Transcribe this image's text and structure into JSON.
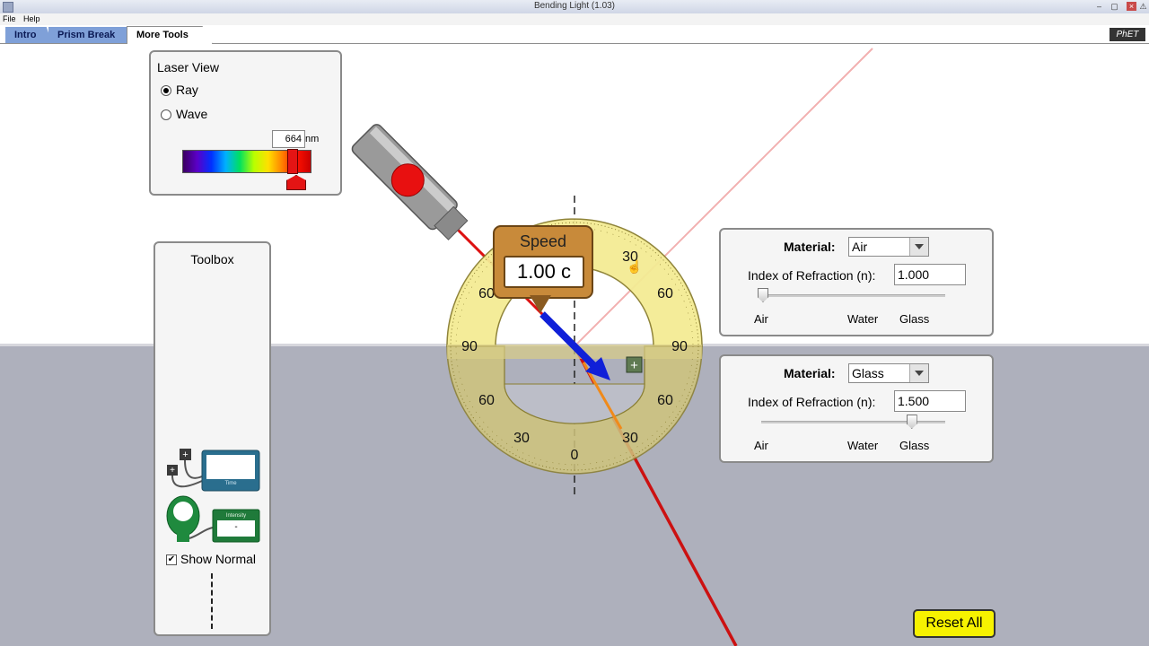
{
  "window": {
    "title": "Bending Light (1.03)"
  },
  "menu": {
    "file": "File",
    "help": "Help"
  },
  "tabs": [
    {
      "label": "Intro",
      "active": false
    },
    {
      "label": "Prism Break",
      "active": false
    },
    {
      "label": "More Tools",
      "active": true
    }
  ],
  "logo": "PhET",
  "laser_view": {
    "title": "Laser View",
    "ray_label": "Ray",
    "wave_label": "Wave",
    "selected": "Ray",
    "wavelength_value": "664",
    "wavelength_unit": "nm"
  },
  "toolbox": {
    "title": "Toolbox",
    "time_label": "Time",
    "intensity_label": "Intensity",
    "intensity_value": "-",
    "show_normal_label": "Show Normal",
    "show_normal_checked": true
  },
  "speed_tool": {
    "label": "Speed",
    "value": "1.00 c"
  },
  "protractor": {
    "labels": [
      "30",
      "60",
      "90",
      "60",
      "30",
      "0",
      "30",
      "60",
      "90",
      "60"
    ]
  },
  "top_medium": {
    "material_label": "Material:",
    "material_value": "Air",
    "index_label": "Index of Refraction (n):",
    "index_value": "1.000",
    "slider_fraction": 0.0,
    "ticks": [
      "Air",
      "Water",
      "Glass"
    ]
  },
  "bottom_medium": {
    "material_label": "Material:",
    "material_value": "Glass",
    "index_label": "Index of Refraction (n):",
    "index_value": "1.500",
    "slider_fraction": 0.85,
    "ticks": [
      "Air",
      "Water",
      "Glass"
    ]
  },
  "reset_all_label": "Reset All",
  "colors": {
    "laser": "#dd1111",
    "water": "#aeb0bc",
    "protractor": "#f2e890",
    "tab_inactive": "#7fa0d8",
    "reset": "#f7f200"
  }
}
